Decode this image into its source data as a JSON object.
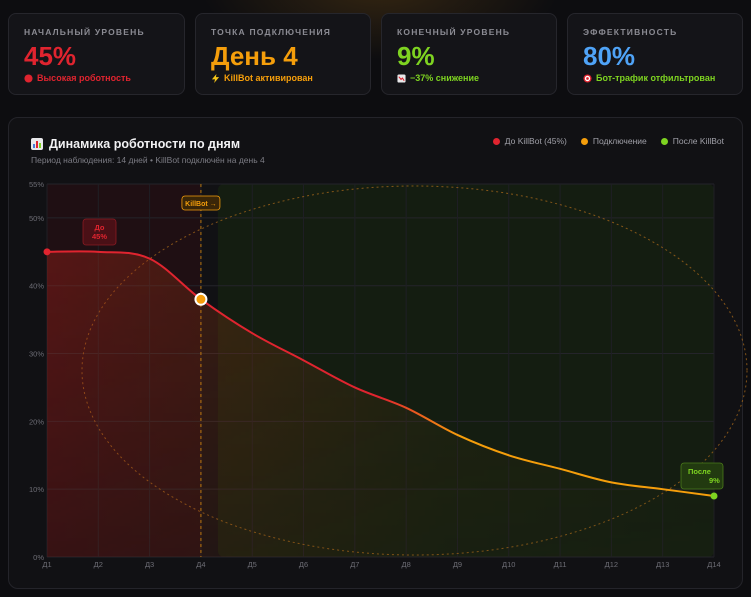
{
  "cards": [
    {
      "label": "НАЧАЛЬНЫЙ УРОВЕНЬ",
      "value": "45%",
      "sub": "Высокая роботность",
      "color": "#e0242f",
      "sub_color": "#e0242f",
      "icon": "red-circle-icon"
    },
    {
      "label": "ТОЧКА ПОДКЛЮЧЕНИЯ",
      "value": "День 4",
      "sub": "KillBot активирован",
      "color": "#f59e0b",
      "sub_color": "#f59e0b",
      "icon": "lightning-icon"
    },
    {
      "label": "КОНЕЧНЫЙ УРОВЕНЬ",
      "value": "9%",
      "sub": "−37% снижение",
      "color": "#7ed321",
      "sub_color": "#7ed321",
      "icon": "chart-down-icon"
    },
    {
      "label": "ЭФФЕКТИВНОСТЬ",
      "value": "80%",
      "sub": "Бот-трафик отфильтрован",
      "color": "#4fa3f7",
      "sub_color": "#7ed321",
      "icon": "target-icon"
    }
  ],
  "panel": {
    "title": "Динамика роботности по дням",
    "title_icon": "bar-chart-icon",
    "subtitle": "Период наблюдения: 14 дней • KillBot подключён на день 4",
    "legend": [
      {
        "label": "До KillBot (45%)",
        "color": "#e0242f"
      },
      {
        "label": "Подключение",
        "color": "#f59e0b"
      },
      {
        "label": "После KillBot",
        "color": "#7ed321"
      }
    ]
  },
  "chart_data": {
    "type": "line",
    "categories": [
      "Д1",
      "Д2",
      "Д3",
      "Д4",
      "Д5",
      "Д6",
      "Д7",
      "Д8",
      "Д9",
      "Д10",
      "Д11",
      "Д12",
      "Д13",
      "Д14"
    ],
    "series": [
      {
        "values": [
          45,
          45,
          44,
          38,
          33,
          29,
          25,
          22,
          18,
          15,
          13,
          11,
          10,
          9
        ]
      }
    ],
    "ylim": [
      0,
      55
    ],
    "yticks": [
      0,
      10,
      20,
      30,
      40,
      50,
      55
    ],
    "ytick_labels": [
      "0%",
      "10%",
      "20%",
      "30%",
      "40%",
      "50%",
      "55%"
    ],
    "annotations": [
      {
        "label": "KillBot →",
        "x_index": 3
      },
      {
        "label_lines": [
          "До",
          "45%"
        ],
        "x_index": 1,
        "y": 45
      },
      {
        "label_lines": [
          "После",
          "9%"
        ],
        "x_index": 13,
        "y": 9
      }
    ],
    "colors": {
      "before": "#e0242f",
      "connect": "#f59e0b",
      "after": "#7ed321"
    },
    "grid": true
  }
}
